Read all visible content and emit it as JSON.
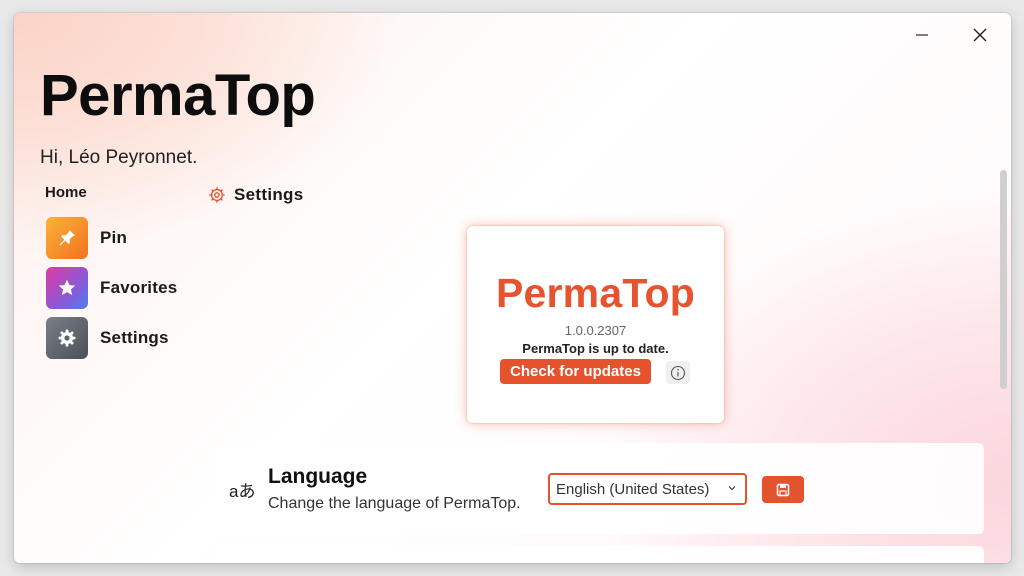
{
  "window": {
    "app_title": "PermaTop",
    "greeting": "Hi, Léo Peyronnet.",
    "controls": {
      "minimize_icon": "minimize-icon",
      "close_icon": "close-icon"
    }
  },
  "sidebar": {
    "home_label": "Home",
    "items": [
      {
        "label": "Pin",
        "icon": "pin-icon"
      },
      {
        "label": "Favorites",
        "icon": "star-icon"
      },
      {
        "label": "Settings",
        "icon": "gear-icon"
      }
    ]
  },
  "breadcrumb": {
    "label": "Settings",
    "icon": "gear-outline-icon"
  },
  "about": {
    "title": "PermaTop",
    "version": "1.0.0.2307",
    "status": "PermaTop is up to date.",
    "check_button": "Check for updates",
    "info_icon": "info-icon"
  },
  "language": {
    "icon_glyph": "aあ",
    "title": "Language",
    "description": "Change the language of PermaTop.",
    "selected": "English (United States)",
    "save_icon": "save-icon"
  },
  "colors": {
    "accent": "#e4532e",
    "pin_gradient": [
      "#fbb23a",
      "#f1721f"
    ],
    "favorites_gradient": [
      "#e23aa0",
      "#4d7df0"
    ],
    "settings_gradient": [
      "#7a7f88",
      "#4b4f57"
    ]
  }
}
